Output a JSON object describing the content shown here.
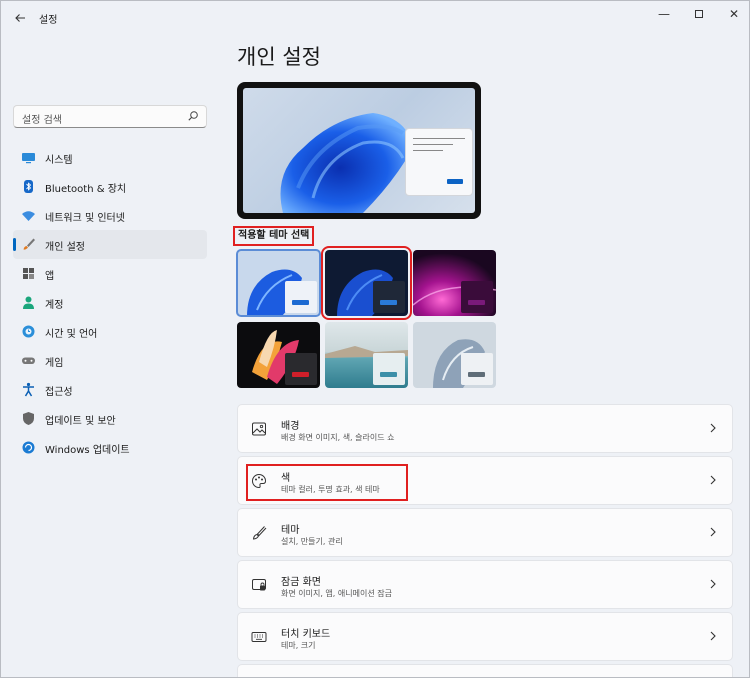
{
  "window": {
    "title": "설정",
    "back_icon": "arrow-left-icon",
    "minimize_glyph": "—",
    "close_glyph": "✕"
  },
  "search": {
    "placeholder": "설정 검색",
    "icon": "search-icon"
  },
  "sidebar": {
    "items": [
      {
        "label": "시스템",
        "icon": "system-monitor-icon",
        "color": "#0078d4"
      },
      {
        "label": "Bluetooth & 장치",
        "icon": "bluetooth-icon",
        "color": "#0067c0"
      },
      {
        "label": "네트워크 및 인터넷",
        "icon": "wifi-icon",
        "color": "#1a73c8"
      },
      {
        "label": "개인 설정",
        "icon": "brush-icon",
        "color": "#c85a1e",
        "selected": true
      },
      {
        "label": "앱",
        "icon": "apps-icon",
        "color": "#555"
      },
      {
        "label": "계정",
        "icon": "person-icon",
        "color": "#10a37f"
      },
      {
        "label": "시간 및 언어",
        "icon": "globe-clock-icon",
        "color": "#1a73c8"
      },
      {
        "label": "게임",
        "icon": "gamepad-icon",
        "color": "#666"
      },
      {
        "label": "접근성",
        "icon": "accessibility-icon",
        "color": "#0a5fb4"
      },
      {
        "label": "업데이트 및 보안",
        "icon": "shield-icon",
        "color": "#555"
      },
      {
        "label": "Windows 업데이트",
        "icon": "sync-icon",
        "color": "#0067c0"
      }
    ]
  },
  "main": {
    "title": "개인 설정",
    "theme_section_label": "적용할 테마 선택",
    "themes": [
      {
        "name": "windows-light",
        "selected": true
      },
      {
        "name": "windows-dark",
        "selected": false
      },
      {
        "name": "glow",
        "selected": false
      },
      {
        "name": "captured-motion",
        "selected": false
      },
      {
        "name": "sunrise",
        "selected": false
      },
      {
        "name": "flow",
        "selected": false
      }
    ],
    "cards": [
      {
        "title": "배경",
        "subtitle": "배경 화면 이미지, 색, 슬라이드 쇼",
        "icon": "image-icon"
      },
      {
        "title": "색",
        "subtitle": "테마 컬러, 투명 효과, 색 테마",
        "icon": "palette-icon"
      },
      {
        "title": "테마",
        "subtitle": "설치, 만들기, 관리",
        "icon": "brush-icon"
      },
      {
        "title": "잠금 화면",
        "subtitle": "화면 이미지, 앱, 애니메이션 잠금",
        "icon": "lock-screen-icon"
      },
      {
        "title": "터치 키보드",
        "subtitle": "테마, 크기",
        "icon": "keyboard-icon"
      }
    ]
  },
  "colors": {
    "accent": "#0067c0",
    "highlight_box": "#e02020"
  }
}
